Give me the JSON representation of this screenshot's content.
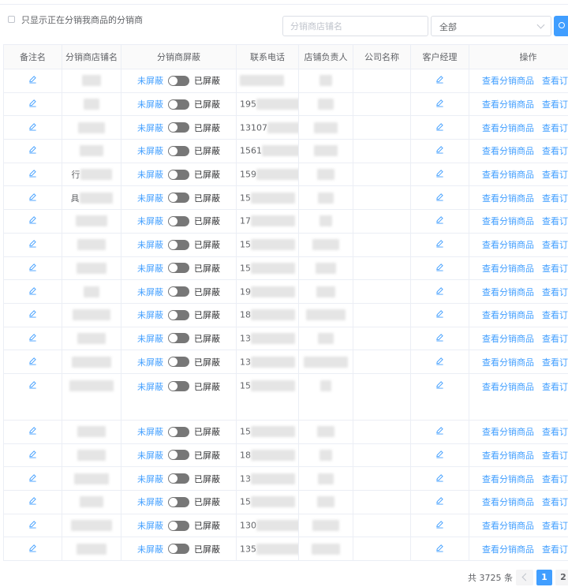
{
  "filter": {
    "only_active_label": "只显示正在分销我商品的分销商",
    "shop_name_placeholder": "分销商店铺名",
    "select_value": "全部"
  },
  "columns": [
    "备注名",
    "分销商店铺名",
    "分销商屏蔽",
    "联系电话",
    "店铺负责人",
    "公司名称",
    "客户经理",
    "操作"
  ],
  "switch_labels": {
    "off": "未屏蔽",
    "on": "已屏蔽"
  },
  "actions": {
    "view_products": "查看分销商品",
    "view_orders": "查看订单"
  },
  "rows": [
    {
      "shop_prefix": "",
      "phone": ""
    },
    {
      "shop_prefix": "",
      "phone": "195"
    },
    {
      "shop_prefix": "",
      "phone": "13107"
    },
    {
      "shop_prefix": "",
      "phone": "1561"
    },
    {
      "shop_prefix": "行",
      "phone": "159"
    },
    {
      "shop_prefix": "具",
      "phone": "15"
    },
    {
      "shop_prefix": "",
      "phone": "17"
    },
    {
      "shop_prefix": "",
      "phone": "15"
    },
    {
      "shop_prefix": "",
      "phone": "15"
    },
    {
      "shop_prefix": "",
      "phone": "19"
    },
    {
      "shop_prefix": "",
      "phone": "18"
    },
    {
      "shop_prefix": "",
      "phone": "13"
    },
    {
      "shop_prefix": "",
      "phone": "13"
    },
    {
      "shop_prefix": "",
      "phone": "15"
    },
    {
      "shop_prefix": "",
      "phone": "15"
    },
    {
      "shop_prefix": "",
      "phone": "18"
    },
    {
      "shop_prefix": "",
      "phone": "13"
    },
    {
      "shop_prefix": "",
      "phone": "15"
    },
    {
      "shop_prefix": "",
      "phone": "130"
    },
    {
      "shop_prefix": "",
      "phone": "135"
    }
  ],
  "pagination": {
    "total_text": "共 3725 条",
    "current_page": "1",
    "next_page": "2"
  },
  "colors": {
    "primary": "#409eff",
    "border": "#ebeef5",
    "switch_off": "#777777"
  }
}
